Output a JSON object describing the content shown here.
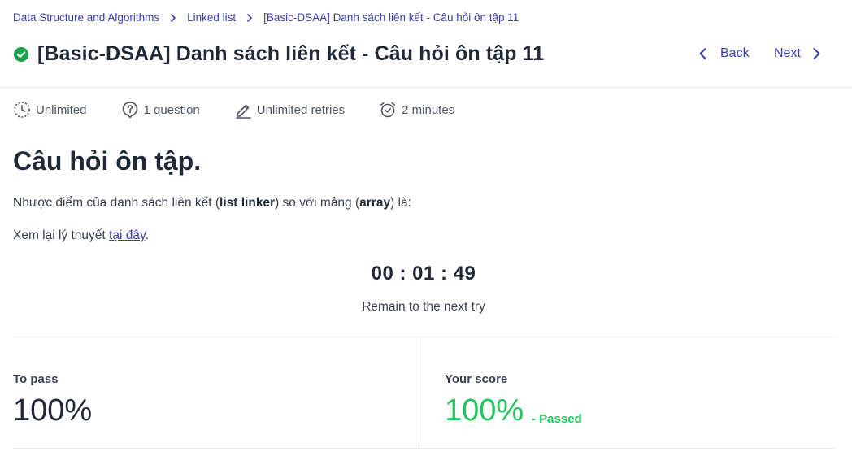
{
  "breadcrumb": {
    "items": [
      "Data Structure and Algorithms",
      "Linked list",
      "[Basic-DSAA] Danh sách liên kết - Câu hỏi ôn tập 11"
    ]
  },
  "header": {
    "title": "[Basic-DSAA] Danh sách liên kết - Câu hỏi ôn tập 11",
    "back_label": "Back",
    "next_label": "Next",
    "status_icon": "check-circle-icon",
    "status_color": "#16a34a"
  },
  "meta": {
    "time_limit": "Unlimited",
    "questions": "1 question",
    "retries": "Unlimited retries",
    "duration": "2 minutes"
  },
  "content": {
    "heading": "Câu hỏi ôn tập.",
    "question_part1": "Nhược điểm của danh sách liên kết (",
    "question_bold1": "list linker",
    "question_part2": ") so với mảng (",
    "question_bold2": "array",
    "question_part3": ") là:",
    "review_text": "Xem lại lý thuyết ",
    "review_link": "tại đây",
    "review_end": "."
  },
  "timer": {
    "value": "00 : 01 : 49",
    "caption": "Remain to the next try"
  },
  "score": {
    "to_pass_label": "To pass",
    "to_pass_value": "100%",
    "your_score_label": "Your score",
    "your_score_value": "100%",
    "status_text": "- Passed",
    "pass_color": "#22c55e"
  },
  "colors": {
    "accent": "#3b3fb6",
    "text": "#1f2937",
    "divider": "#e5e7eb"
  }
}
